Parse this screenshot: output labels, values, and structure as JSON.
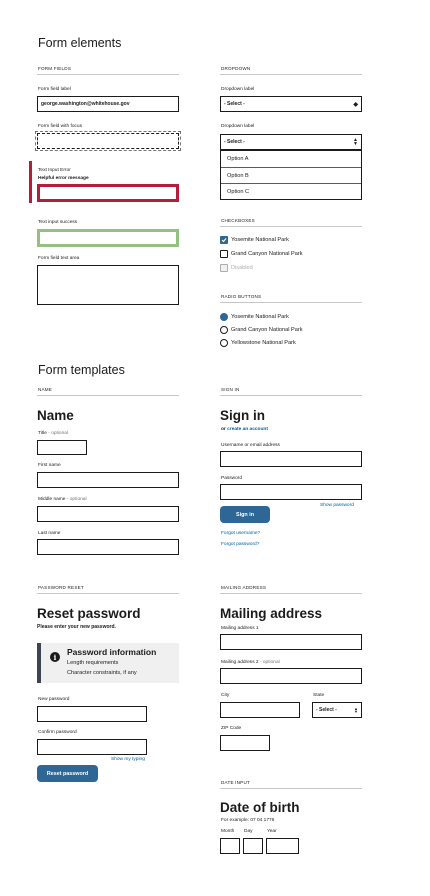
{
  "form_elements": {
    "title": "Form elements",
    "form_fields": {
      "section": "FORM FIELDS",
      "field_label": "Form field label",
      "field_value": "george.washington@whitehouse.gov",
      "focus_label": "Form field with focus",
      "error_label": "Text Input Error",
      "error_message": "Helpful error message",
      "success_label": "Text input success",
      "textarea_label": "Form field text area"
    },
    "dropdown": {
      "section": "DROPDOWN",
      "label1": "Dropdown label",
      "value1": "- Select -",
      "label2": "Dropdown label",
      "value2": "- Select -",
      "options": [
        "Option A",
        "Option B",
        "Option C"
      ]
    },
    "checkboxes": {
      "section": "CHECKBOXES",
      "items": [
        "Yosemite National Park",
        "Grand Canyon National Park",
        "Disabled"
      ]
    },
    "radio_buttons": {
      "section": "RADIO BUTTONS",
      "items": [
        "Yosemite National Park",
        "Grand Canyon National Park",
        "Yellowstone National Park"
      ]
    }
  },
  "form_templates": {
    "title": "Form templates",
    "name": {
      "section": "NAME",
      "heading": "Name",
      "title_label": "Title",
      "optional": "- optional",
      "first_label": "First name",
      "middle_label": "Middle name",
      "middle_optional": "- optional",
      "last_label": "Last name"
    },
    "sign_in": {
      "section": "SIGN IN",
      "heading": "Sign in",
      "or_text": "or",
      "create_link": "create an account",
      "username_label": "Username or email address",
      "password_label": "Password",
      "show_password": "Show password",
      "button": "Sign in",
      "forgot_username": "Forgot username?",
      "forgot_password": "Forgot password?"
    },
    "password_reset": {
      "section": "PASSWORD RESET",
      "heading": "Reset password",
      "instruction": "Please enter your new password.",
      "info_title": "Password information",
      "info_line1": "Length requirements",
      "info_line2": "Character constraints, if any",
      "new_label": "New password",
      "confirm_label": "Confirm password",
      "show_typing": "Show my typing",
      "button": "Reset password"
    },
    "mailing_address": {
      "section": "MAILING ADDRESS",
      "heading": "Mailing address",
      "addr1_label": "Mailing address 1",
      "addr2_label": "Mailing address 2",
      "addr2_optional": "- optional",
      "city_label": "City",
      "state_label": "State",
      "state_value": "- Select -",
      "zip_label": "ZIP Code"
    },
    "date_input": {
      "section": "DATE INPUT",
      "heading": "Date of birth",
      "example": "For example: 07 04 1776",
      "month_label": "Month",
      "day_label": "Day",
      "year_label": "Year"
    }
  },
  "colors": {
    "error": "#b31e3a",
    "success": "#94c080",
    "button": "#2e6696",
    "link": "#005ea2",
    "checkbox": "#2e6696"
  }
}
